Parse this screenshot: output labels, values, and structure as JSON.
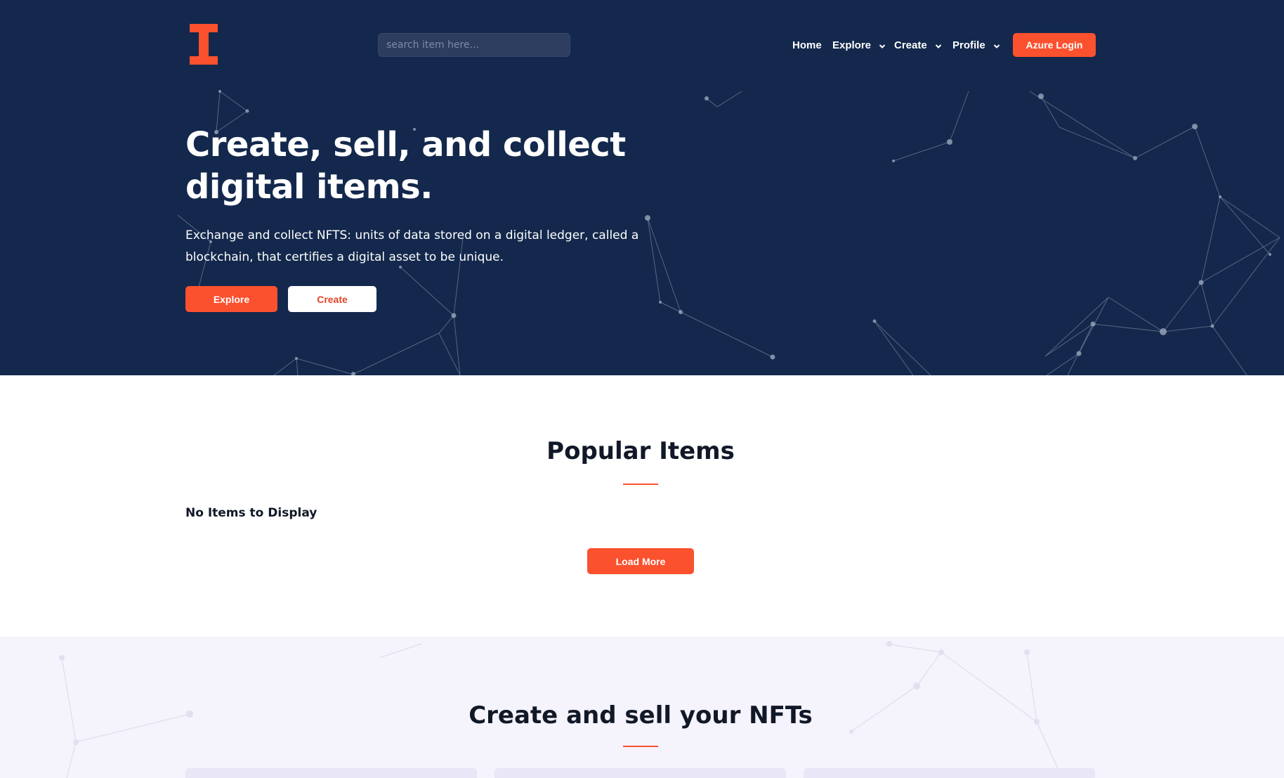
{
  "header": {
    "search_placeholder": "search item here...",
    "nav": [
      {
        "label": "Home",
        "has_dropdown": false
      },
      {
        "label": "Explore",
        "has_dropdown": true
      },
      {
        "label": "Create",
        "has_dropdown": true
      },
      {
        "label": "Profile",
        "has_dropdown": true
      }
    ],
    "login_label": "Azure Login"
  },
  "hero": {
    "title": "Create, sell, and collect digital items.",
    "subtitle": "Exchange and collect NFTS: units of data stored on a digital ledger, called a blockchain, that certifies a digital asset to be unique.",
    "explore_label": "Explore",
    "create_label": "Create"
  },
  "popular": {
    "title": "Popular Items",
    "empty_message": "No Items to Display",
    "load_more_label": "Load More"
  },
  "sell": {
    "title": "Create and sell your NFTs"
  },
  "colors": {
    "hero_bg": "#13284c",
    "accent": "#fb512f",
    "section_bg": "#f5f3fc",
    "text_dark": "#111827"
  }
}
